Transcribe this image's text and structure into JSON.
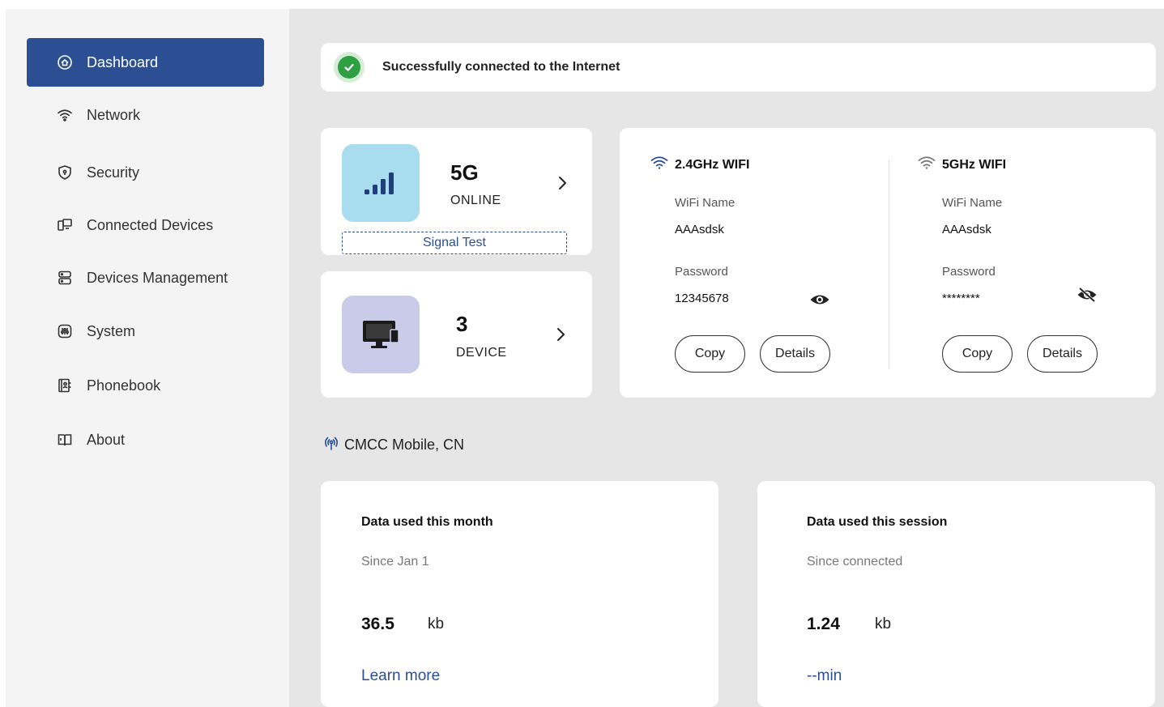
{
  "sidebar": {
    "items": [
      {
        "label": "Dashboard",
        "icon": "home-shield-icon",
        "active": true
      },
      {
        "label": "Network",
        "icon": "wifi-icon"
      },
      {
        "label": "Security",
        "icon": "shield-icon"
      },
      {
        "label": "Connected Devices",
        "icon": "devices-icon"
      },
      {
        "label": "Devices Management",
        "icon": "server-icon"
      },
      {
        "label": "System",
        "icon": "system-icon"
      },
      {
        "label": "Phonebook",
        "icon": "phonebook-icon"
      },
      {
        "label": "About",
        "icon": "book-icon"
      }
    ]
  },
  "status": {
    "text": "Successfully connected to the Internet",
    "color": "#2ea043"
  },
  "network": {
    "type": "5G",
    "state": "ONLINE",
    "signal_test_label": "Signal Test",
    "signal_icon": "signal-bars-icon"
  },
  "devices": {
    "count": "3",
    "label": "DEVICE",
    "icon": "monitor-icon"
  },
  "wifi": [
    {
      "title": "2.4GHz WIFI",
      "name_label": "WiFi Name",
      "name": "AAAsdsk",
      "password_label": "Password",
      "password": "12345678",
      "password_visible": true,
      "copy_label": "Copy",
      "details_label": "Details"
    },
    {
      "title": "5GHz WIFI",
      "name_label": "WiFi Name",
      "name": "AAAsdsk",
      "password_label": "Password",
      "password": "********",
      "password_visible": false,
      "copy_label": "Copy",
      "details_label": "Details"
    }
  ],
  "operator": {
    "text": "CMCC Mobile, CN",
    "icon": "antenna-icon"
  },
  "usage": {
    "month": {
      "title": "Data used this month",
      "since": "Since Jan 1",
      "value": "36.5",
      "unit": "kb",
      "link": "Learn more"
    },
    "session": {
      "title": "Data used this session",
      "since": "Since connected",
      "value": "1.24",
      "unit": "kb",
      "duration": "--min"
    }
  },
  "colors": {
    "accent": "#2b4f92",
    "sidebar_bg": "#f4f4f4",
    "main_bg": "#e6e6e6",
    "network_tile": "#a9dcef",
    "device_tile": "#c9cbe8"
  }
}
